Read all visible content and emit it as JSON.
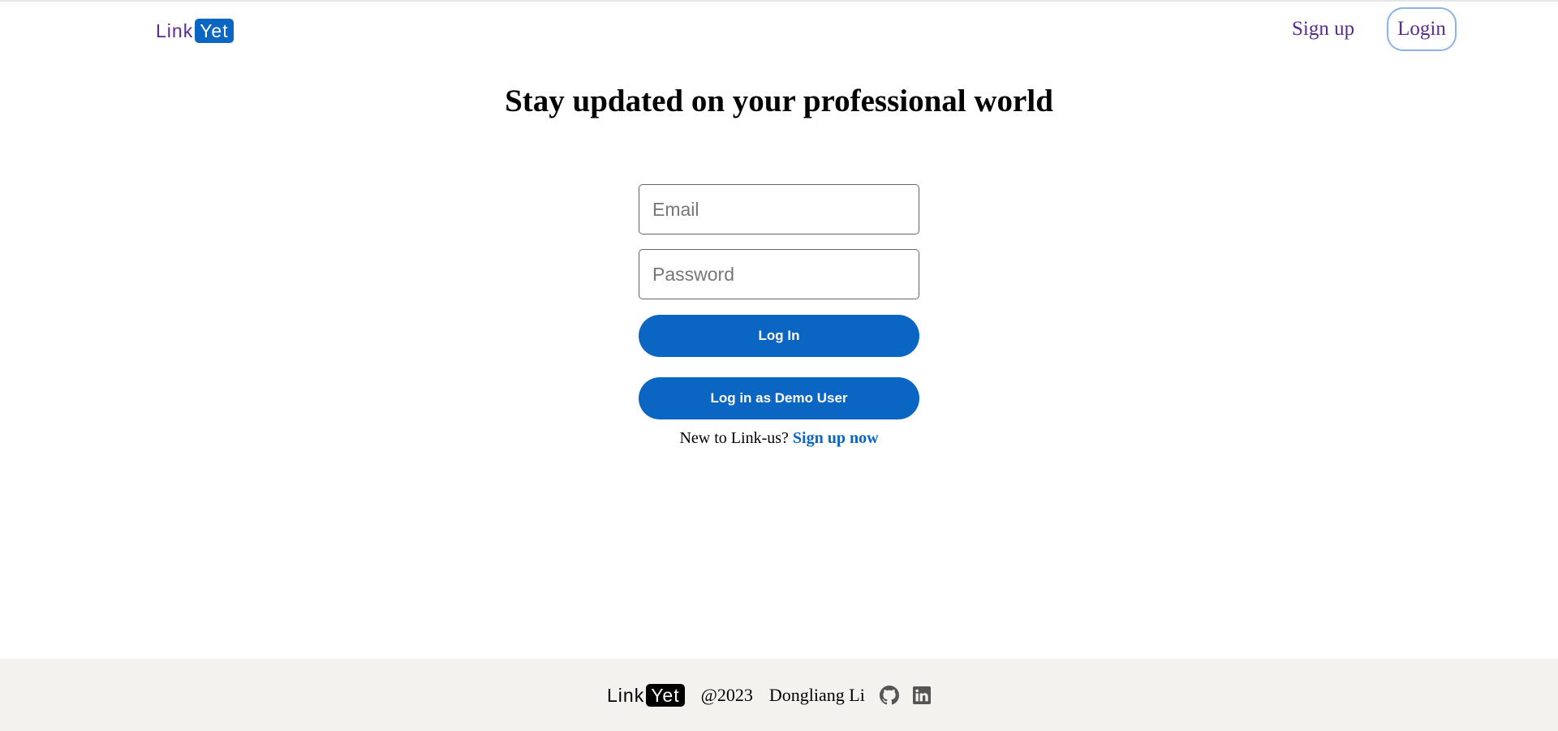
{
  "header": {
    "logo": {
      "part1": "Link",
      "part2": "Yet"
    },
    "signup_label": "Sign up",
    "login_label": "Login"
  },
  "main": {
    "title": "Stay updated on your professional world",
    "email_placeholder": "Email",
    "password_placeholder": "Password",
    "login_button": "Log In",
    "demo_button": "Log in as Demo User",
    "signup_prompt": "New to Link-us?",
    "signup_link": "Sign up now"
  },
  "footer": {
    "logo": {
      "part1": "Link",
      "part2": "Yet"
    },
    "copyright": "@2023",
    "author": "Dongliang Li",
    "icons": [
      "github-icon",
      "linkedin-icon"
    ]
  },
  "colors": {
    "brand_blue": "#0a66c2",
    "brand_purple": "#5a2a91",
    "footer_bg": "#f3f2ef"
  }
}
